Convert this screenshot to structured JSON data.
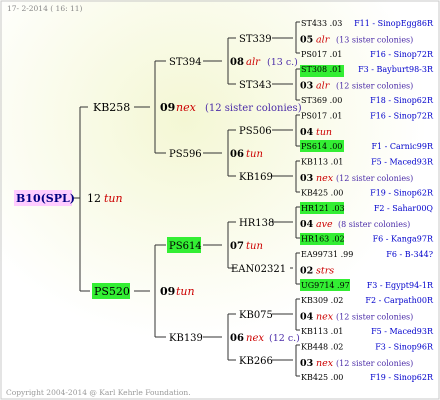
{
  "header": {
    "date": "17-  2-2014 ( 16: 11)"
  },
  "footer": {
    "copyright": "Copyright 2004-2014 @ Karl Kehrle Foundation."
  },
  "colors": {
    "highlight_green": "#33ee33",
    "root_pink": "#ffccff",
    "number_red": "#cc0000",
    "note_purple": "#4b2ca8",
    "link_blue": "#0000cc",
    "tree_line": "#333333"
  },
  "tree": {
    "root": {
      "name": "B10(SPL)"
    },
    "gen1": [
      {
        "name": "KB258",
        "year": "12",
        "line": "tun"
      },
      {
        "name": "PS520"
      }
    ],
    "gen2": [
      {
        "name": "ST394",
        "year": "09",
        "line": "nex",
        "note": "(12 sister colonies)"
      },
      {
        "name": "PS596"
      },
      {
        "name": "PS614",
        "year": "09",
        "line": "tun"
      },
      {
        "name": "KB139"
      }
    ],
    "gen3": [
      {
        "name": "ST339",
        "year": "08",
        "line": "alr",
        "note": "(13 c.)"
      },
      {
        "name": "ST343"
      },
      {
        "name": "PS506",
        "year": "06",
        "line": "tun"
      },
      {
        "name": "KB169"
      },
      {
        "name": "HR138",
        "year": "07",
        "line": "tun"
      },
      {
        "name": "EAN02321"
      },
      {
        "name": "KB075",
        "year": "06",
        "line": "nex",
        "note": "(12 c.)"
      },
      {
        "name": "KB266"
      }
    ],
    "gen4": [
      {
        "name": "ST433 .03",
        "mother": "F11 - SinopEgg86R"
      },
      {
        "year": "05",
        "line": "alr",
        "note": "(13 sister colonies)"
      },
      {
        "name": "PS017 .01",
        "mother": "F16 - Sinop72R"
      },
      {
        "name": "ST308 .01",
        "mother": "F3 - Bayburt98-3R"
      },
      {
        "year": "03",
        "line": "alr",
        "note": "(12 sister colonies)"
      },
      {
        "name": "ST369 .00",
        "mother": "F18 - Sinop62R"
      },
      {
        "name": "PS017 .01",
        "mother": "F16 - Sinop72R"
      },
      {
        "year": "04",
        "line": "tun"
      },
      {
        "name": "PS614 .00",
        "mother": "F1 - Carnic99R"
      },
      {
        "name": "KB113 .01",
        "mother": "F5 - Maced93R"
      },
      {
        "year": "03",
        "line": "nex",
        "note": "(12 sister colonies)"
      },
      {
        "name": "KB425 .00",
        "mother": "F19 - Sinop62R"
      },
      {
        "name": "HR121 .03",
        "mother": "F2 - Sahar00Q"
      },
      {
        "year": "04",
        "line": "ave",
        "note": "(8 sister colonies)"
      },
      {
        "name": "HR163 .02",
        "mother": "F6 - Kanga97R"
      },
      {
        "name": "EA99731 .99",
        "mother": "F6 - B-344?"
      },
      {
        "year": "02",
        "line": "strs"
      },
      {
        "name": "UG9714 .97",
        "mother": "F3 - Egypt94-1R"
      },
      {
        "name": "KB309 .02",
        "mother": "F2 - Carpath00R"
      },
      {
        "year": "04",
        "line": "nex",
        "note": "(12 sister colonies)"
      },
      {
        "name": "KB113 .01",
        "mother": "F5 - Maced93R"
      },
      {
        "name": "KB448 .02",
        "mother": "F3 - Sinop96R"
      },
      {
        "year": "03",
        "line": "nex",
        "note": "(12 sister colonies)"
      },
      {
        "name": "KB425 .00",
        "mother": "F19 - Sinop62R"
      }
    ]
  }
}
